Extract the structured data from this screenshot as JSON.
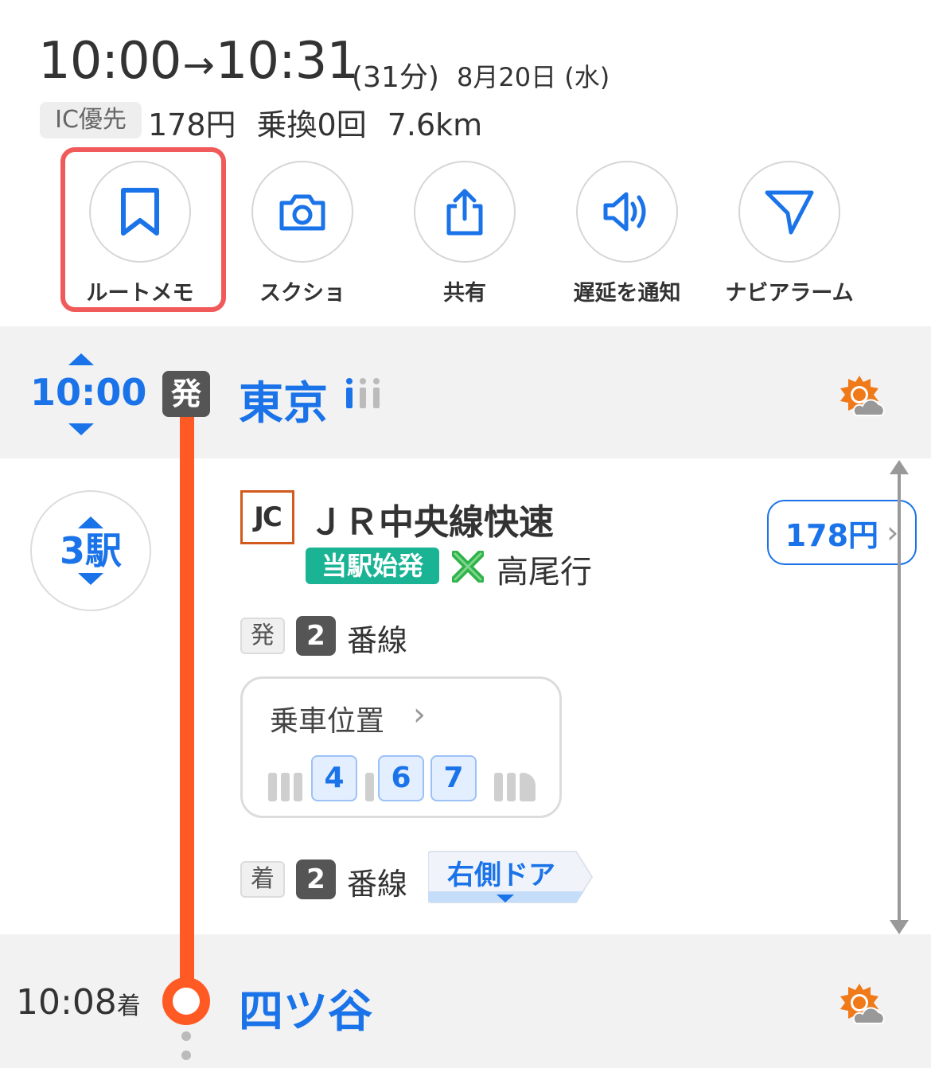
{
  "summary": {
    "dep_time": "10:00",
    "arrow": "→",
    "arr_time": "10:31",
    "duration": "(31分)",
    "date": "8月20日 (水)",
    "ic_badge": "IC優先",
    "fare": "178円",
    "transfers": "乗換0回",
    "distance": "7.6km"
  },
  "actions": [
    {
      "label": "ルートメモ",
      "icon": "bookmark-icon"
    },
    {
      "label": "スクショ",
      "icon": "camera-icon"
    },
    {
      "label": "共有",
      "icon": "share-icon"
    },
    {
      "label": "遅延を通知",
      "icon": "speaker-icon"
    },
    {
      "label": "ナビアラーム",
      "icon": "navigation-arrow-icon"
    }
  ],
  "departure": {
    "time": "10:00",
    "badge": "発",
    "station": "東京",
    "weather_icon": "sunny-cloudy-icon"
  },
  "segment": {
    "stops": "3駅",
    "line_code": "JC",
    "line_name": "ＪＲ中央線快速",
    "first_badge": "当駅始発",
    "destination": "高尾行",
    "fare": "178円",
    "dep_badge": "発",
    "dep_track": "2",
    "track_label": "番線",
    "boarding_title": "乗車位置",
    "cars": [
      "4",
      "6",
      "7"
    ],
    "arr_badge": "着",
    "arr_track": "2",
    "door": "右側ドア"
  },
  "arrival": {
    "time": "10:08",
    "suffix": "着",
    "station": "四ツ谷",
    "weather_icon": "sunny-cloudy-icon"
  },
  "colors": {
    "accent": "#1a73e8",
    "route": "#ff5a24",
    "highlight": "#f05a5a",
    "first_badge": "#1ab394"
  }
}
